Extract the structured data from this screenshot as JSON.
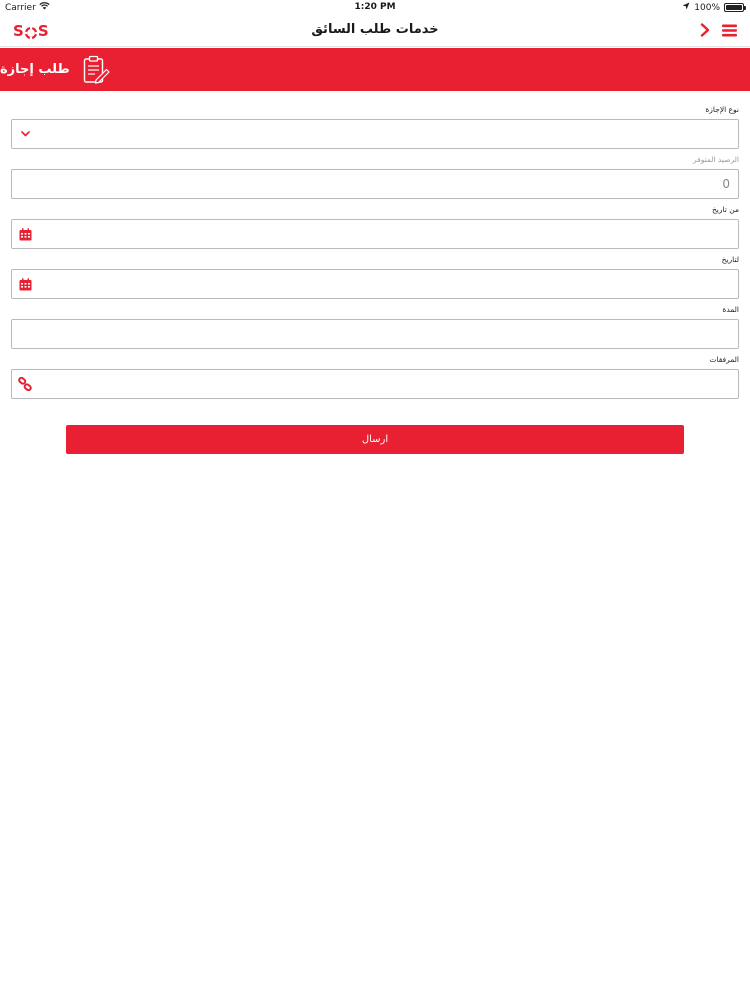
{
  "status_bar": {
    "carrier": "Carrier",
    "time": "1:20 PM",
    "battery": "100%",
    "battery_level": 1.0
  },
  "nav": {
    "title": "خدمات طلب السائق",
    "logo_s1": "S",
    "logo_s2": "S",
    "back_icon": "chevron-right-icon",
    "menu_icon": "hamburger-menu-icon"
  },
  "section": {
    "title": "طلب إجازة",
    "icon": "clipboard-edit-icon"
  },
  "form": {
    "leave_type": {
      "label": "نوع الإجازة",
      "value": ""
    },
    "available_balance": {
      "label": "الرصيد المتوفر",
      "value": "0"
    },
    "from_date": {
      "label": "من تاريخ",
      "value": ""
    },
    "to_date": {
      "label": "لتاريخ",
      "value": ""
    },
    "duration": {
      "label": "المدة",
      "value": ""
    },
    "attachments": {
      "label": "المرفقات",
      "value": ""
    },
    "submit_label": "ارسال"
  },
  "colors": {
    "brand_red": "#e82031",
    "border": "#b9b9b9"
  }
}
